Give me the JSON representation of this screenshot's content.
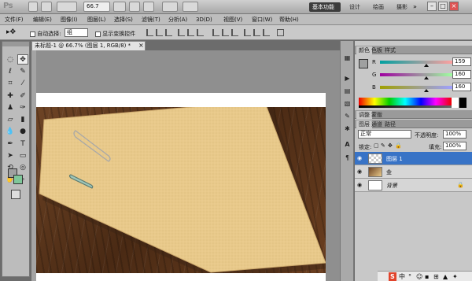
{
  "app": {
    "logo": "Ps",
    "zoom": "66.7",
    "workspaces": [
      "基本功能",
      "设计",
      "绘画",
      "摄影"
    ],
    "window_controls": [
      "–",
      "□",
      "×"
    ]
  },
  "menu": [
    "文件(F)",
    "编辑(E)",
    "图像(I)",
    "图层(L)",
    "选择(S)",
    "滤镜(T)",
    "分析(A)",
    "3D(D)",
    "视图(V)",
    "窗口(W)",
    "帮助(H)"
  ],
  "options": {
    "auto_select_label": "自动选择:",
    "auto_select_value": "组",
    "show_transform_label": "显示变换控件"
  },
  "document": {
    "tab_title": "未标题-1 @ 66.7% (图层 1, RGB/8) *",
    "close": "×"
  },
  "color_panel": {
    "tabs": [
      "颜色",
      "色板",
      "样式"
    ],
    "r_label": "R",
    "r_value": "159",
    "g_label": "G",
    "g_value": "160",
    "b_label": "B",
    "b_value": "160",
    "fg_color": "#9fa0a0"
  },
  "layers_panel": {
    "tabs": [
      "图层",
      "通道",
      "路径"
    ],
    "mode_tabs": [
      "调整",
      "蒙版"
    ],
    "blend_mode": "正常",
    "opacity_label": "不透明度:",
    "opacity_value": "100%",
    "lock_label": "锁定:",
    "fill_label": "填充:",
    "fill_value": "100%",
    "layers": [
      {
        "name": "图层 1",
        "selected": true
      },
      {
        "name": "金",
        "selected": false
      },
      {
        "name": "背景",
        "selected": false
      }
    ]
  },
  "tray": {
    "ime": "S",
    "items": [
      "中",
      "°",
      "☺",
      "▪",
      "⊞",
      "▲",
      "✦"
    ]
  }
}
